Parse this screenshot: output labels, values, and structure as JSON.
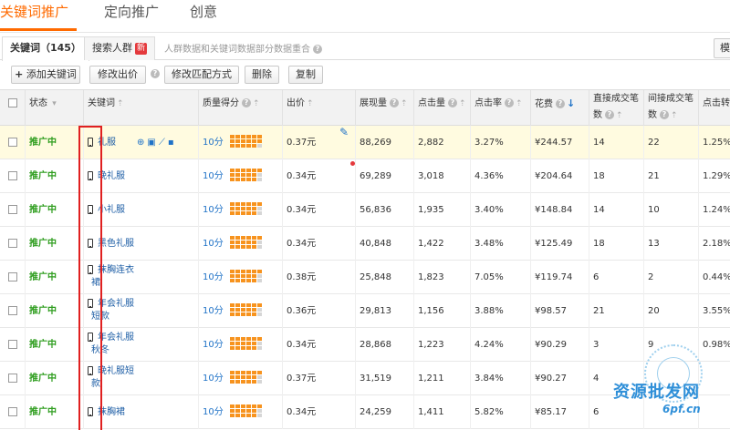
{
  "top_tabs": [
    {
      "label": "关键词推广"
    },
    {
      "label": "定向推广"
    },
    {
      "label": "创意"
    }
  ],
  "sub_tabs": {
    "keywords_label": "关键词（145）",
    "crowd_label": "搜索人群",
    "new_badge": "新",
    "note": "人群数据和关键词数据部分数据重合",
    "corner": "模"
  },
  "toolbar": {
    "add_icon": "+",
    "add_keyword": "添加关键词",
    "edit_bid": "修改出价",
    "edit_match": "修改匹配方式",
    "delete": "删除",
    "copy": "复制"
  },
  "icons": {
    "help": "?",
    "sort": "⇡",
    "sort_down": "↓",
    "dropdown": "▾",
    "edit": "✎",
    "tool_globe": "⊕",
    "tool_report": "▣",
    "tool_chart": "⟋",
    "tool_trash": "▪"
  },
  "columns": {
    "status": "状态",
    "keyword": "关键词",
    "quality": "质量得分",
    "bid": "出价",
    "impressions": "展现量",
    "clicks": "点击量",
    "ctr": "点击率",
    "cost": "花费",
    "direct_line1": "直接成交笔",
    "direct_line2": "数",
    "indirect_line1": "间接成交笔",
    "indirect_line2": "数",
    "conv": "点击转化"
  },
  "colors": {
    "accent": "#ff6a00",
    "status_green": "#2e9d1e",
    "link_blue": "#1f72c7",
    "bar_orange": "#f7931e",
    "bar_gray": "#d6d6d6",
    "outline_red": "#e02020"
  },
  "rows": [
    {
      "status": "推广中",
      "kw1": "礼服",
      "kw2": "",
      "score": "10分",
      "bid": "0.37元",
      "impressions": "88,269",
      "clicks": "2,882",
      "ctr": "3.27%",
      "cost": "¥244.57",
      "direct": "14",
      "indirect": "22",
      "conv": "1.25%"
    },
    {
      "status": "推广中",
      "kw1": "晚礼服",
      "kw2": "",
      "score": "10分",
      "bid": "0.34元",
      "impressions": "69,289",
      "clicks": "3,018",
      "ctr": "4.36%",
      "cost": "¥204.64",
      "direct": "18",
      "indirect": "21",
      "conv": "1.29%"
    },
    {
      "status": "推广中",
      "kw1": "小礼服",
      "kw2": "",
      "score": "10分",
      "bid": "0.34元",
      "impressions": "56,836",
      "clicks": "1,935",
      "ctr": "3.40%",
      "cost": "¥148.84",
      "direct": "14",
      "indirect": "10",
      "conv": "1.24%"
    },
    {
      "status": "推广中",
      "kw1": "黑色礼服",
      "kw2": "",
      "score": "10分",
      "bid": "0.34元",
      "impressions": "40,848",
      "clicks": "1,422",
      "ctr": "3.48%",
      "cost": "¥125.49",
      "direct": "18",
      "indirect": "13",
      "conv": "2.18%"
    },
    {
      "status": "推广中",
      "kw1": "抹胸连衣",
      "kw2": "裙",
      "score": "10分",
      "bid": "0.38元",
      "impressions": "25,848",
      "clicks": "1,823",
      "ctr": "7.05%",
      "cost": "¥119.74",
      "direct": "6",
      "indirect": "2",
      "conv": "0.44%"
    },
    {
      "status": "推广中",
      "kw1": "年会礼服",
      "kw2": "短款",
      "score": "10分",
      "bid": "0.36元",
      "impressions": "29,813",
      "clicks": "1,156",
      "ctr": "3.88%",
      "cost": "¥98.57",
      "direct": "21",
      "indirect": "20",
      "conv": "3.55%"
    },
    {
      "status": "推广中",
      "kw1": "年会礼服",
      "kw2": "秋冬",
      "score": "10分",
      "bid": "0.34元",
      "impressions": "28,868",
      "clicks": "1,223",
      "ctr": "4.24%",
      "cost": "¥90.29",
      "direct": "3",
      "indirect": "9",
      "conv": "0.98%"
    },
    {
      "status": "推广中",
      "kw1": "晚礼服短",
      "kw2": "款",
      "score": "10分",
      "bid": "0.37元",
      "impressions": "31,519",
      "clicks": "1,211",
      "ctr": "3.84%",
      "cost": "¥90.27",
      "direct": "4",
      "indirect": "",
      "conv": ""
    },
    {
      "status": "推广中",
      "kw1": "抹胸裙",
      "kw2": "",
      "score": "10分",
      "bid": "0.34元",
      "impressions": "24,259",
      "clicks": "1,411",
      "ctr": "5.82%",
      "cost": "¥85.17",
      "direct": "6",
      "indirect": "",
      "conv": ""
    }
  ],
  "watermark": {
    "text": "资源批发网",
    "url": "6pf.cn"
  }
}
